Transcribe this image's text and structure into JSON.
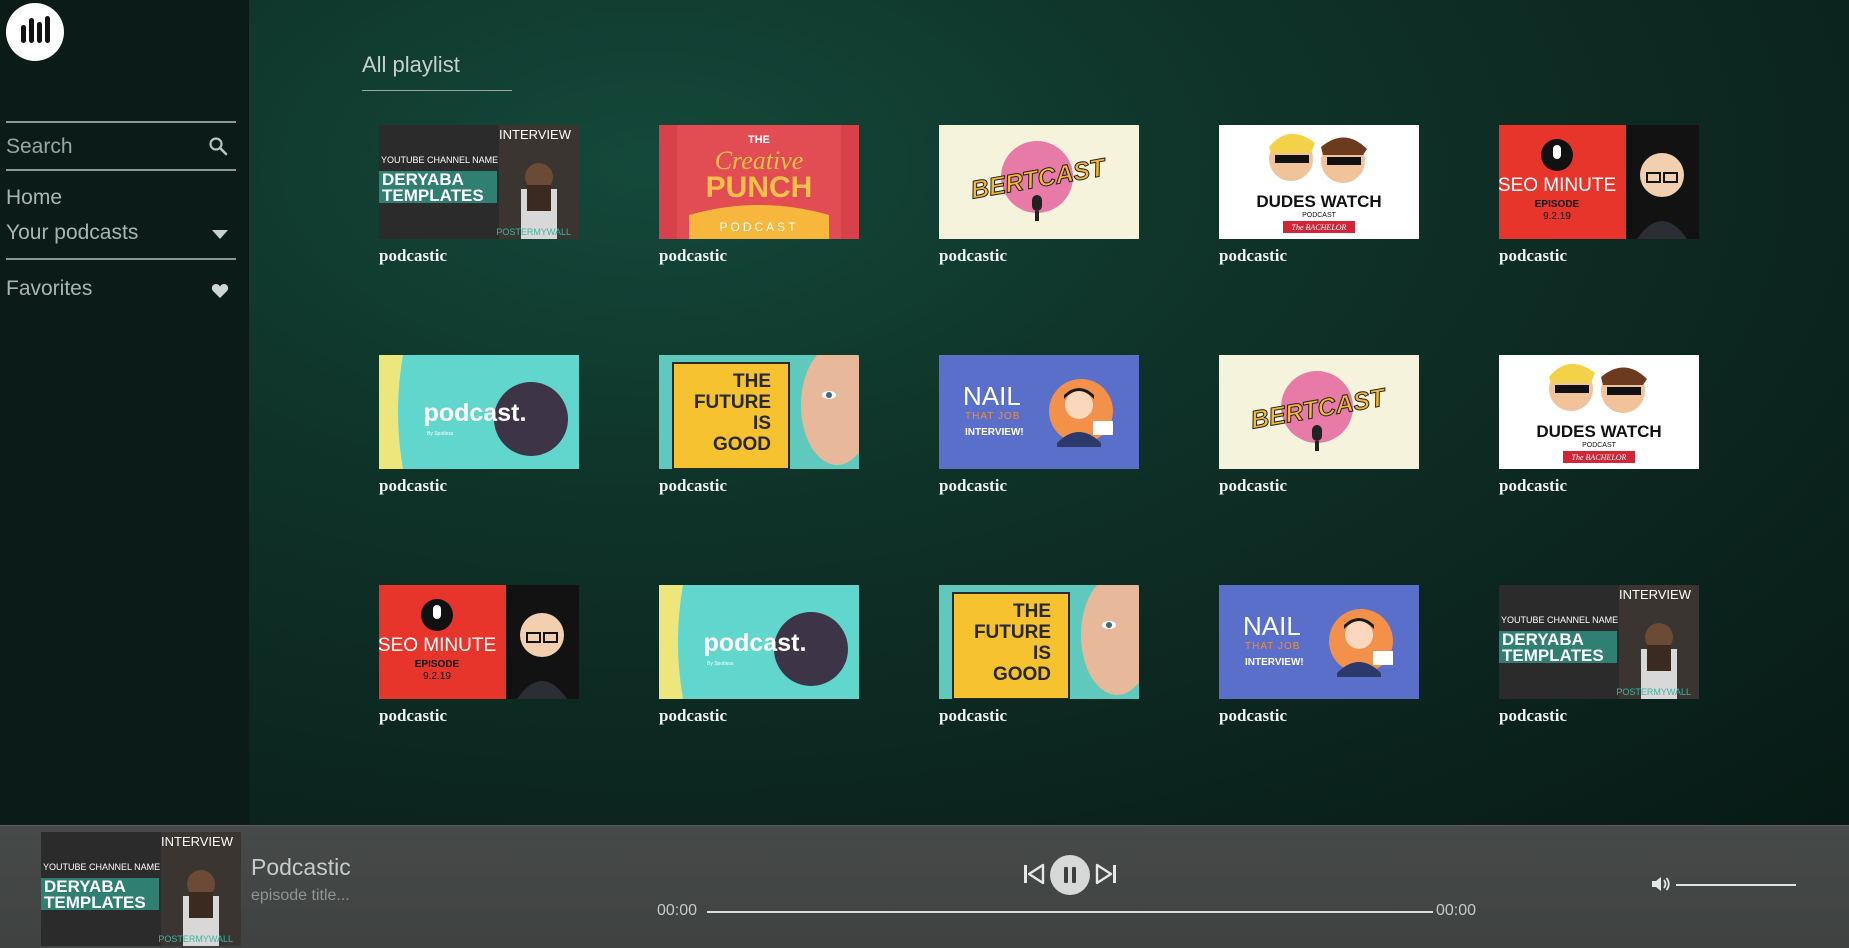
{
  "sidebar": {
    "logo_icon": "equalizer-bars-logo",
    "search": {
      "placeholder": "Search",
      "value": "",
      "icon": "search-icon"
    },
    "nav": {
      "home": "Home",
      "your_podcasts": "Your podcasts",
      "favorites": "Favorites"
    }
  },
  "main": {
    "heading": "All playlist",
    "cards": [
      {
        "title": "podcastic",
        "art": "deryaba"
      },
      {
        "title": "podcastic",
        "art": "creative"
      },
      {
        "title": "podcastic",
        "art": "bertcast"
      },
      {
        "title": "podcastic",
        "art": "dudes"
      },
      {
        "title": "podcastic",
        "art": "seo"
      },
      {
        "title": "podcastic",
        "art": "podcast"
      },
      {
        "title": "podcastic",
        "art": "future"
      },
      {
        "title": "podcastic",
        "art": "nail"
      },
      {
        "title": "podcastic",
        "art": "bertcast"
      },
      {
        "title": "podcastic",
        "art": "dudes"
      },
      {
        "title": "podcastic",
        "art": "seo"
      },
      {
        "title": "podcastic",
        "art": "podcast"
      },
      {
        "title": "podcastic",
        "art": "future"
      },
      {
        "title": "podcastic",
        "art": "nail"
      },
      {
        "title": "podcastic",
        "art": "deryaba"
      }
    ]
  },
  "artwork_text": {
    "deryaba": {
      "tag": "INTERVIEW",
      "channel": "YOUTUBE CHANNEL NAME",
      "line1": "DERYABA",
      "line2": "TEMPLATES",
      "credit": "POSTERMYWALL"
    },
    "creative": {
      "the": "THE",
      "line1": "Creative",
      "line2": "PUNCH",
      "bottom": "PODCAST"
    },
    "bertcast": {
      "name": "BERTCAST"
    },
    "dudes": {
      "top": "DUDES",
      "mid": "WATCH",
      "sub": "PODCAST",
      "banner": "The BACHELOR"
    },
    "seo": {
      "line1": "SEO MINUTE",
      "line2": "EPISODE",
      "line3": "9.2.19"
    },
    "podcast": {
      "word": "podcast.",
      "by": "By Spotless"
    },
    "future": {
      "l1": "THE",
      "l2": "FUTURE",
      "l3": "IS",
      "l4": "GOOD"
    },
    "nail": {
      "l1": "NAIL",
      "l2": "THAT JOB",
      "l3": "INTERVIEW!"
    }
  },
  "player": {
    "now_playing_art": "deryaba",
    "title": "Podcastic",
    "episode": "episode title...",
    "current_time": "00:00",
    "duration": "00:00",
    "progress": 0,
    "volume": 1.0,
    "icons": {
      "prev": "skip-previous-icon",
      "play": "pause-icon",
      "next": "skip-next-icon",
      "volume": "speaker-icon"
    }
  },
  "colors": {
    "sidebar_bg": "#0b1c18",
    "main_bg": "#0f3329",
    "player_bg": "#444746"
  }
}
